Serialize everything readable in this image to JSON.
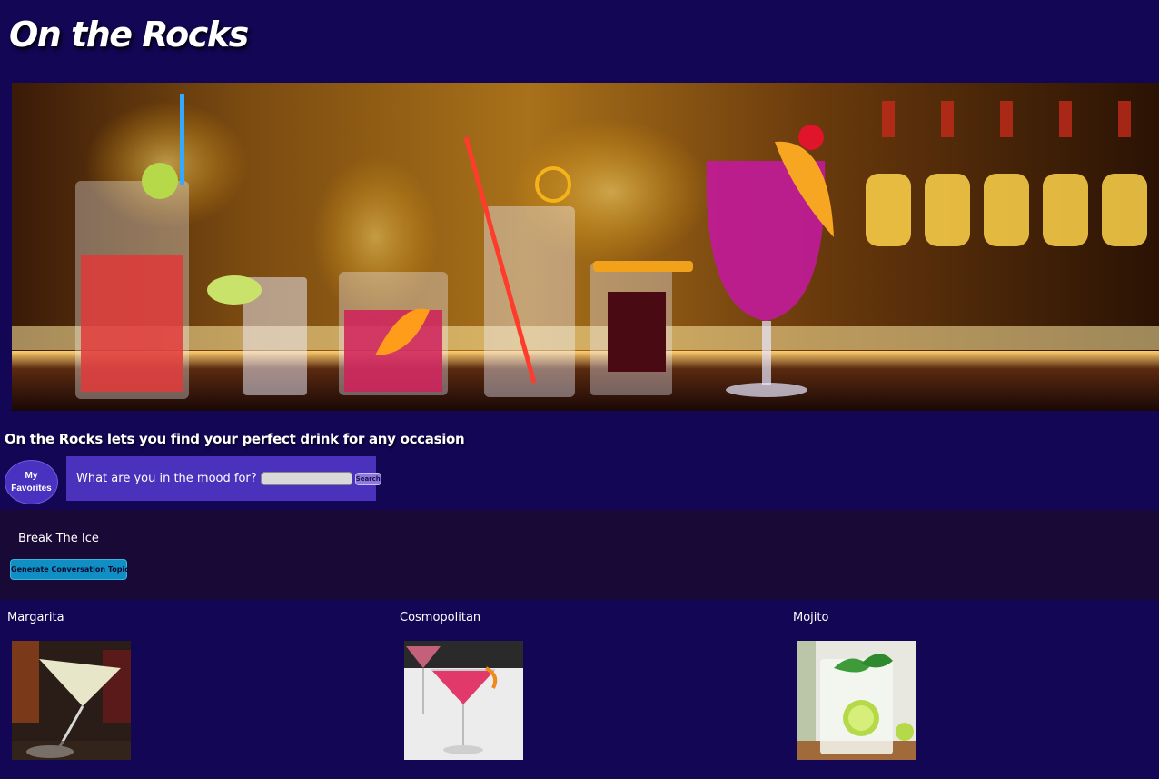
{
  "site": {
    "title": "On the Rocks"
  },
  "intro": {
    "tagline": "On the Rocks lets you find your perfect drink for any occasion"
  },
  "favorites": {
    "label": "My Favorites"
  },
  "search": {
    "prompt": "What are you in the mood for?",
    "value": "",
    "placeholder": "",
    "button_label": "Search"
  },
  "ice_breaker": {
    "title": "Break The Ice",
    "button_label": "Generate Conversation Topic"
  },
  "drinks": [
    {
      "name": "Margarita"
    },
    {
      "name": "Cosmopolitan"
    },
    {
      "name": "Mojito"
    }
  ],
  "colors": {
    "page_bg": "#130654",
    "section_bg": "#180936",
    "search_panel": "#4a32bd",
    "accent_button": "#0f8fc4"
  }
}
